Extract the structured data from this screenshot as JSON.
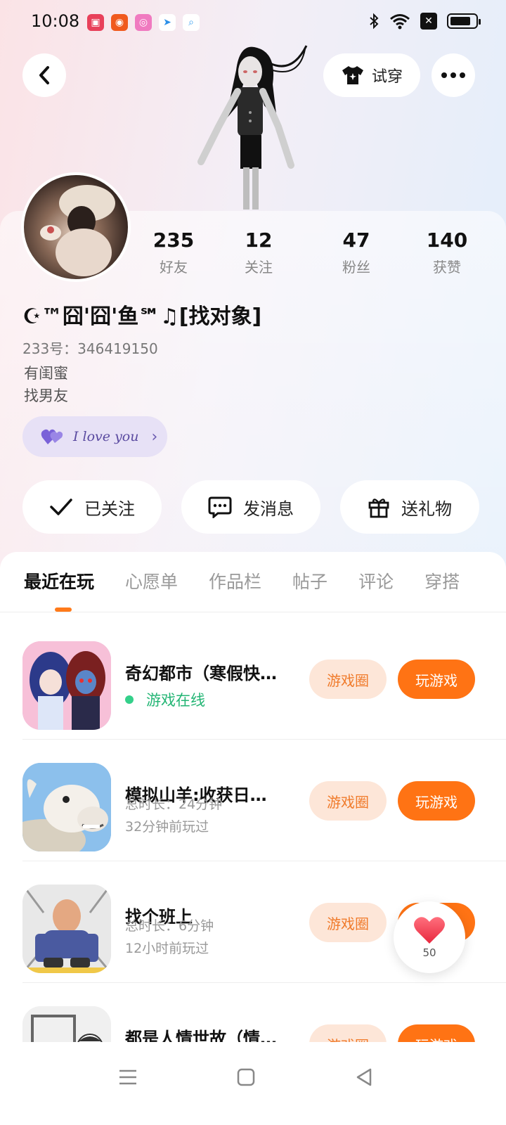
{
  "status_bar": {
    "time": "10:08",
    "notification_icons": [
      {
        "name": "screen-record-icon",
        "color": "#e8405a",
        "glyph": "▣"
      },
      {
        "name": "app-red-icon",
        "color": "#f05a1e",
        "glyph": "◉"
      },
      {
        "name": "app-pink-icon",
        "color": "#f07ac0",
        "glyph": "◎"
      },
      {
        "name": "send-icon",
        "color": "#2b8fe8",
        "glyph": "➤"
      },
      {
        "name": "search-app-icon",
        "color": "#3aa0f0",
        "glyph": "⌕"
      }
    ],
    "battery_level": 0.7
  },
  "header": {
    "tryon_label": "试穿"
  },
  "profile": {
    "stats": [
      {
        "value": "235",
        "label": "好友"
      },
      {
        "value": "12",
        "label": "关注"
      },
      {
        "value": "47",
        "label": "粉丝"
      },
      {
        "value": "140",
        "label": "获赞"
      }
    ],
    "nickname": "☪™囧'囧'鱼℠♫[找对象]",
    "uid": "233号：346419150",
    "bio_line1": "有闺蜜",
    "bio_line2": "找男友",
    "tag_text": "I love you"
  },
  "actions": {
    "follow_label": "已关注",
    "message_label": "发消息",
    "gift_label": "送礼物"
  },
  "tabs": [
    "最近在玩",
    "心愿单",
    "作品栏",
    "帖子",
    "评论",
    "穿搭"
  ],
  "games": [
    {
      "title": "奇幻都市（寒假快…",
      "status": "游戏在线",
      "circle_label": "游戏圈",
      "play_label": "玩游戏"
    },
    {
      "title": "模拟山羊:收获日…",
      "duration": "总时长：24分钟",
      "last_played": "32分钟前玩过",
      "circle_label": "游戏圈",
      "play_label": "玩游戏"
    },
    {
      "title": "找个班上",
      "duration": "总时长：6分钟",
      "last_played": "12小时前玩过",
      "circle_label": "游戏圈",
      "play_label": "玩游戏"
    },
    {
      "title": "都是人情世故（情…",
      "circle_label": "游戏圈",
      "play_label": "玩游戏"
    }
  ],
  "like_button": {
    "count": "50"
  },
  "colors": {
    "accent": "#ff7314",
    "accent_light": "#fde6d8",
    "online": "#23b574",
    "tag_bg": "#e7e1f6"
  }
}
